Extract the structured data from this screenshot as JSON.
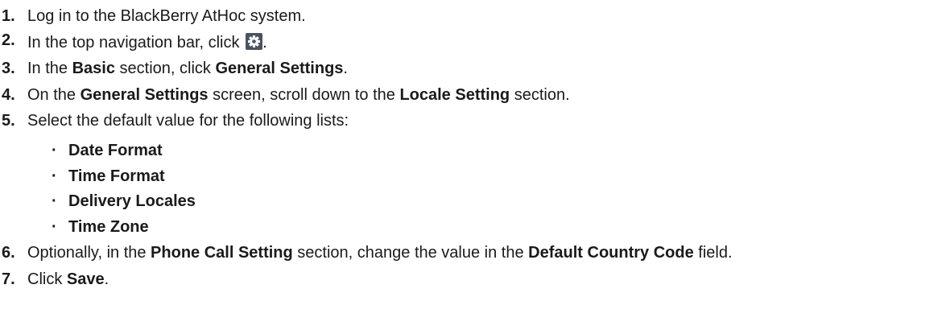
{
  "steps": {
    "s1": {
      "num": "1.",
      "text": "Log in to the BlackBerry AtHoc system."
    },
    "s2": {
      "num": "2.",
      "pre": "In the top navigation bar, click",
      "post": "."
    },
    "s3": {
      "num": "3.",
      "a": "In the ",
      "b1": "Basic",
      "c": " section, click ",
      "b2": "General Settings",
      "d": "."
    },
    "s4": {
      "num": "4.",
      "a": "On the ",
      "b1": "General Settings",
      "c": " screen, scroll down to the ",
      "b2": "Locale Setting",
      "d": " section."
    },
    "s5": {
      "num": "5.",
      "text": "Select the default value for the following lists:",
      "items": [
        "Date Format",
        "Time Format",
        "Delivery Locales",
        "Time Zone"
      ],
      "bullet": "·"
    },
    "s6": {
      "num": "6.",
      "a": "Optionally, in the ",
      "b1": "Phone Call Setting",
      "c": " section, change the value in the ",
      "b2": "Default Country Code",
      "d": " field."
    },
    "s7": {
      "num": "7.",
      "a": "Click ",
      "b1": "Save",
      "d": "."
    }
  },
  "icons": {
    "settings": "gear-icon"
  },
  "colors": {
    "text": "#1a1a1a",
    "gear_bg": "#4a5360",
    "gear_fg": "#ffffff"
  }
}
